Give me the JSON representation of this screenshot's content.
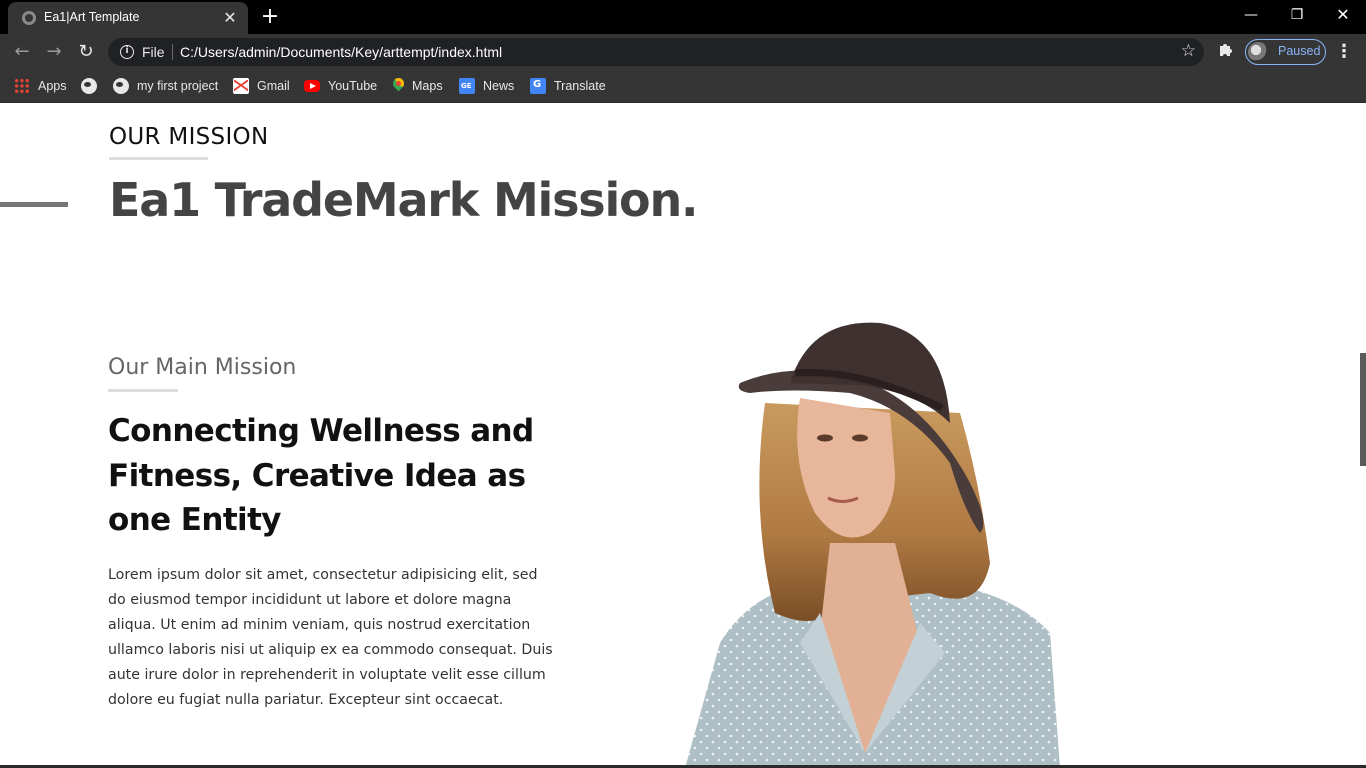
{
  "browser": {
    "tab_title": "Ea1|Art Template",
    "tab_close": "✕",
    "new_tab": "+",
    "window_controls": {
      "minimize": "—",
      "maximize": "❐",
      "close": "✕"
    },
    "nav": {
      "back": "←",
      "forward": "→",
      "reload": "↻"
    },
    "omnibox": {
      "info": "i",
      "scheme_label": "File",
      "url": "C:/Users/admin/Documents/Key/arttempt/index.html",
      "star": "☆"
    },
    "extensions_icon": "puzzle-icon",
    "profile": {
      "status": "Paused"
    },
    "menu": "⋮"
  },
  "bookmarks": [
    {
      "label": "Apps",
      "icon": "apps-grid-icon"
    },
    {
      "label": "",
      "icon": "globe-icon"
    },
    {
      "label": "my first project",
      "icon": "globe-icon"
    },
    {
      "label": "Gmail",
      "icon": "gmail-icon"
    },
    {
      "label": "YouTube",
      "icon": "youtube-icon"
    },
    {
      "label": "Maps",
      "icon": "maps-icon"
    },
    {
      "label": "News",
      "icon": "news-icon"
    },
    {
      "label": "Translate",
      "icon": "translate-icon"
    }
  ],
  "page": {
    "section_label": "OUR MISSION",
    "section_title": "Ea1 TradeMark Mission.",
    "mission": {
      "eyebrow": "Our Main Mission",
      "heading": "Connecting Wellness and Fitness, Creative Idea as one Entity",
      "body": "Lorem ipsum dolor sit amet, consectetur adipisicing elit, sed do eiusmod tempor incididunt ut labore et dolore magna aliqua. Ut enim ad minim veniam, quis nostrud exercitation ullamco laboris nisi ut aliquip ex ea commodo consequat. Duis aute irure dolor in reprehenderit in voluptate velit esse cillum dolore eu fugiat nulla pariatur. Excepteur sint occaecat."
    },
    "colors": {
      "hero_title": "#444444",
      "heading": "#111111",
      "accent_underline": "#dddddd"
    }
  }
}
